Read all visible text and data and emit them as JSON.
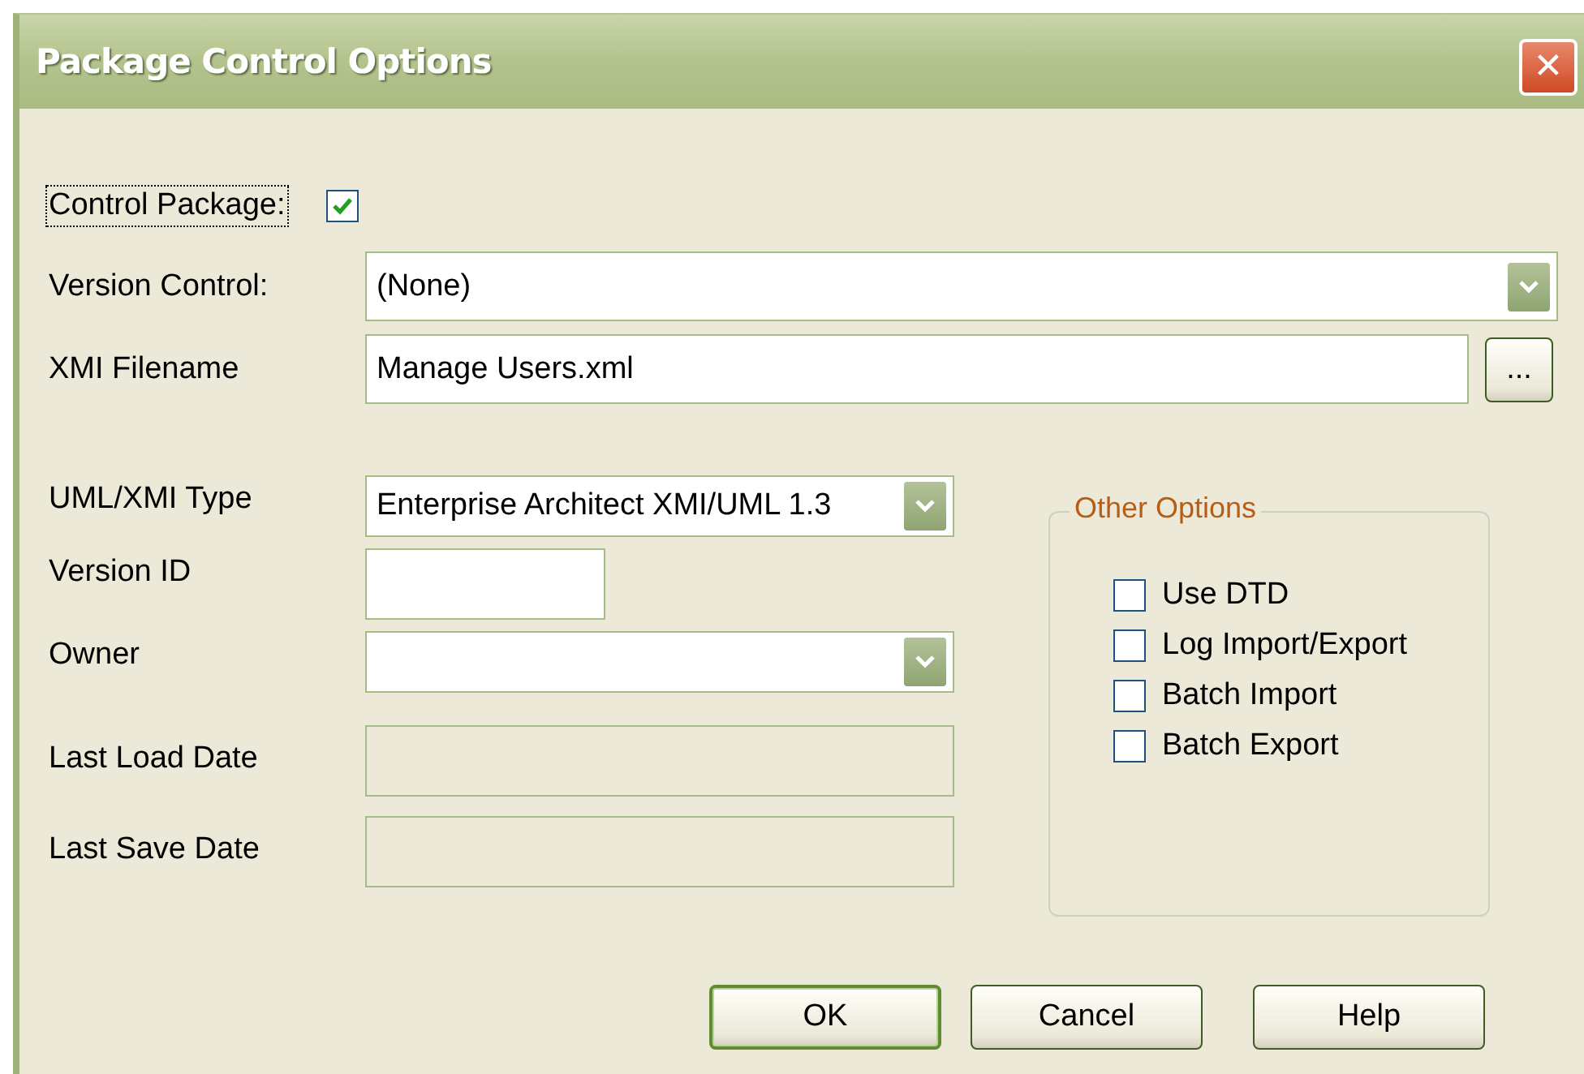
{
  "window": {
    "title": "Package Control Options",
    "close": "✕"
  },
  "control_package": {
    "label": "Control Package:",
    "checked": true,
    "focused": true
  },
  "version_control": {
    "label": "Version Control:",
    "value": "(None)"
  },
  "xmi_filename": {
    "label": "XMI Filename",
    "value": "Manage Users.xml",
    "browse": "..."
  },
  "fields": [
    {
      "label": "UML/XMI Type",
      "kind": "combo",
      "value": "Enterprise Architect XMI/UML 1.3",
      "disabled": false
    },
    {
      "label": "Version ID",
      "kind": "short",
      "disabled": false
    },
    {
      "label": "Owner",
      "kind": "combo",
      "disabled": false
    },
    {
      "label": "Last Load Date",
      "kind": "text",
      "disabled": true
    },
    {
      "label": "Last Save Date",
      "kind": "text",
      "disabled": true
    }
  ],
  "other_options": {
    "title": "Other Options",
    "options": [
      {
        "label": "Use DTD",
        "checked": false
      },
      {
        "label": "Log Import/Export",
        "checked": false
      },
      {
        "label": "Batch Import",
        "checked": false
      },
      {
        "label": "Batch Export",
        "checked": false
      }
    ]
  },
  "buttons": [
    {
      "label": "OK",
      "default": true
    },
    {
      "label": "Cancel",
      "default": false
    },
    {
      "label": "Help",
      "default": false
    }
  ]
}
